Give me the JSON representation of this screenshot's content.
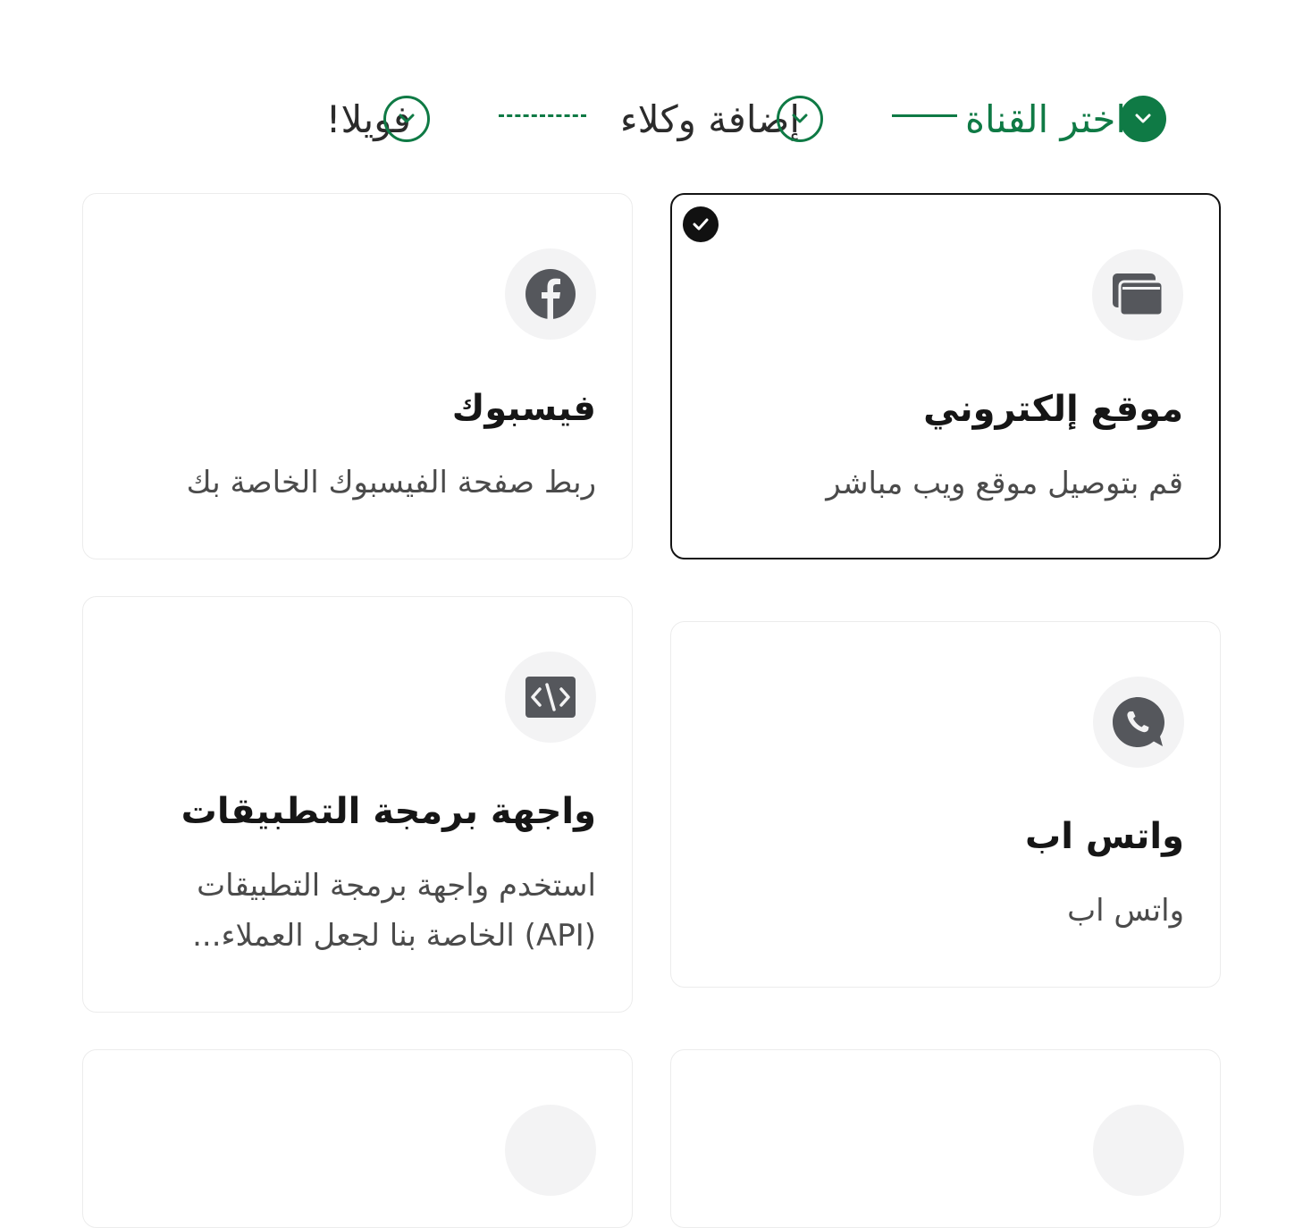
{
  "stepper": {
    "steps": [
      {
        "label": "اختر القناة",
        "state": "active"
      },
      {
        "label": "إضافة وكلاء",
        "state": "pending"
      },
      {
        "label": "فويلا!",
        "state": "pending"
      }
    ],
    "accent_color": "#0f7a45"
  },
  "cards": [
    {
      "title": "موقع إلكتروني",
      "description": "قم بتوصيل موقع ويب مباشر",
      "icon": "browser-windows-icon",
      "selected": true
    },
    {
      "title": "فيسبوك",
      "description": "ربط صفحة الفيسبوك الخاصة بك",
      "icon": "facebook-icon",
      "selected": false
    },
    {
      "title": "واتس اب",
      "description": "واتس اب",
      "icon": "whatsapp-icon",
      "selected": false
    },
    {
      "title": "واجهة برمجة التطبيقات",
      "description": "استخدم واجهة برمجة التطبيقات (API) الخاصة بنا لجعل العملاء...",
      "icon": "code-icon",
      "selected": false
    }
  ]
}
